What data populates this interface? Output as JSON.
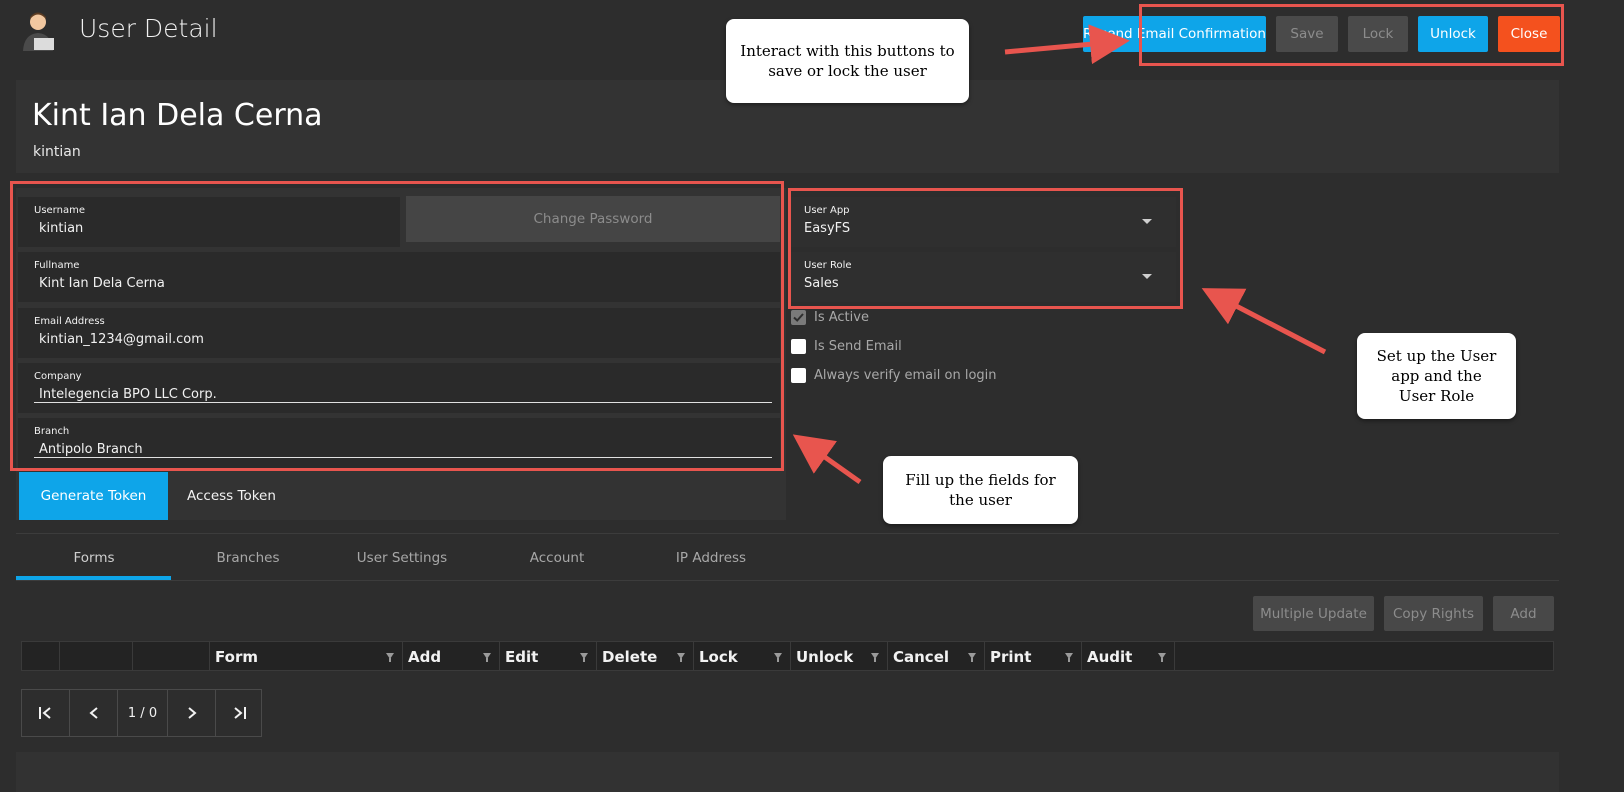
{
  "header": {
    "title": "User Detail",
    "buttons": {
      "resend": "Resend Email Confirmation",
      "save": "Save",
      "lock": "Lock",
      "unlock": "Unlock",
      "close": "Close"
    }
  },
  "user": {
    "display_name": "Kint Ian Dela Cerna",
    "username": "kintian"
  },
  "form": {
    "username": {
      "label": "Username",
      "value": "kintian"
    },
    "change_password": "Change Password",
    "fullname": {
      "label": "Fullname",
      "value": "Kint Ian Dela Cerna"
    },
    "email": {
      "label": "Email Address",
      "value": "kintian_1234@gmail.com"
    },
    "company": {
      "label": "Company",
      "value": "Intelegencia BPO LLC Corp."
    },
    "branch": {
      "label": "Branch",
      "value": "Antipolo Branch"
    },
    "user_app": {
      "label": "User App",
      "value": "EasyFS"
    },
    "user_role": {
      "label": "User Role",
      "value": "Sales"
    },
    "checkboxes": [
      {
        "label": "Is Active",
        "checked": true
      },
      {
        "label": "Is Send Email",
        "checked": false
      },
      {
        "label": "Always verify email on login",
        "checked": false
      }
    ],
    "generate_token": "Generate Token",
    "access_token": "Access Token"
  },
  "tabs": [
    "Forms",
    "Branches",
    "User Settings",
    "Account",
    "IP Address"
  ],
  "grid": {
    "buttons": {
      "multiple_update": "Multiple Update",
      "copy_rights": "Copy Rights",
      "add": "Add"
    },
    "columns": [
      "Form",
      "Add",
      "Edit",
      "Delete",
      "Lock",
      "Unlock",
      "Cancel",
      "Print",
      "Audit"
    ],
    "pager_text": "1 / 0"
  },
  "callouts": {
    "buttons_note": "Interact with this buttons to save or lock the user",
    "app_role_note": "Set up the User app and the User Role",
    "fields_note": "Fill up the fields for the user"
  },
  "colors": {
    "accent": "#0ea5e9",
    "close": "#f4511e",
    "highlight": "#e8554e"
  }
}
